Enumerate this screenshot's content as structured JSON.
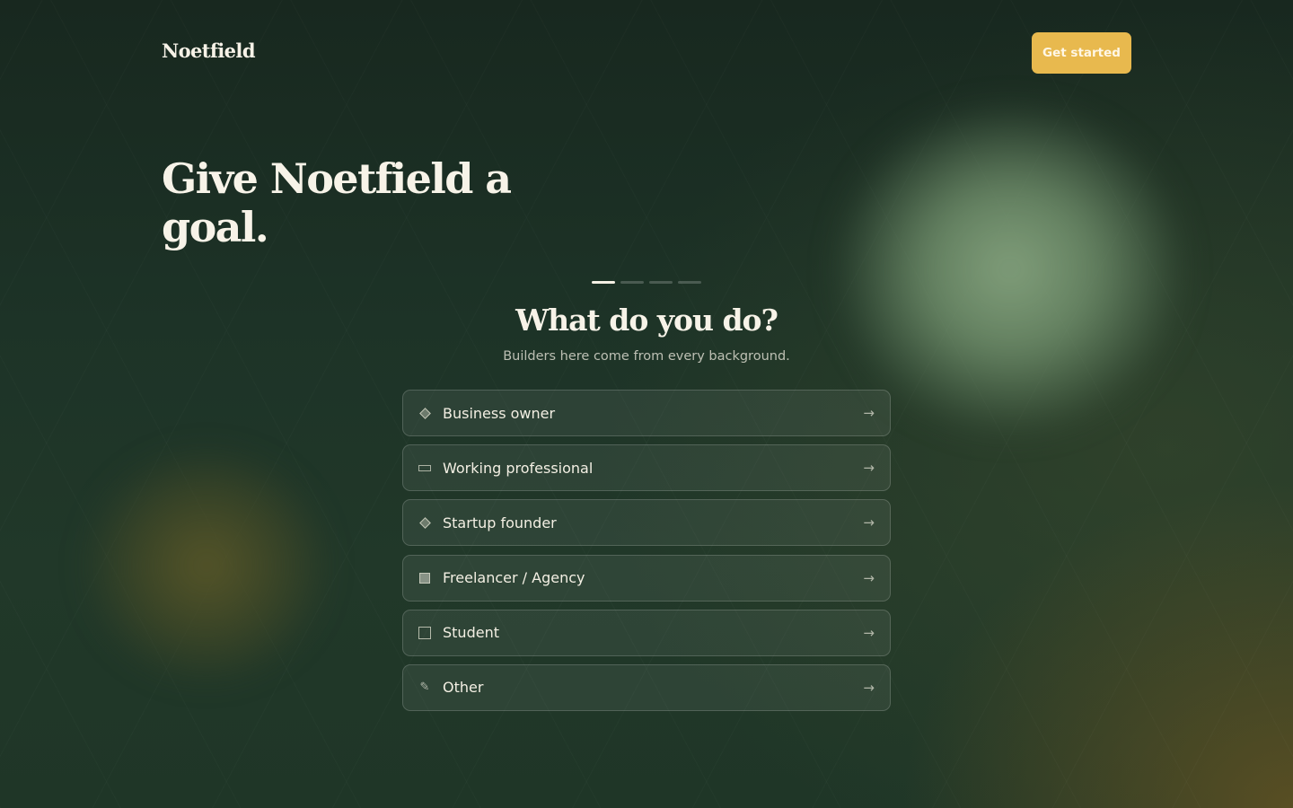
{
  "brand": {
    "name": "Noetfield"
  },
  "header": {
    "cta_label": "Get started"
  },
  "hero": {
    "title": "Give Noetfield a goal."
  },
  "progress": {
    "current_step": 1,
    "total_steps": 4
  },
  "question": {
    "title": "What do you do?",
    "subtitle": "Builders here come from every background."
  },
  "options": [
    {
      "label": "Business owner",
      "icon": "diamond-icon",
      "arrow": "→"
    },
    {
      "label": "Working professional",
      "icon": "rectangle-icon",
      "arrow": "→"
    },
    {
      "label": "Startup founder",
      "icon": "diamond-icon",
      "arrow": "→"
    },
    {
      "label": "Freelancer / Agency",
      "icon": "building-icon",
      "arrow": "→"
    },
    {
      "label": "Student",
      "icon": "square-icon",
      "arrow": "→"
    },
    {
      "label": "Other",
      "icon": "pencil-icon",
      "arrow": "→"
    }
  ],
  "colors": {
    "accent": "#e8b94e",
    "background": "#1d3327",
    "text": "#f3efe3"
  }
}
